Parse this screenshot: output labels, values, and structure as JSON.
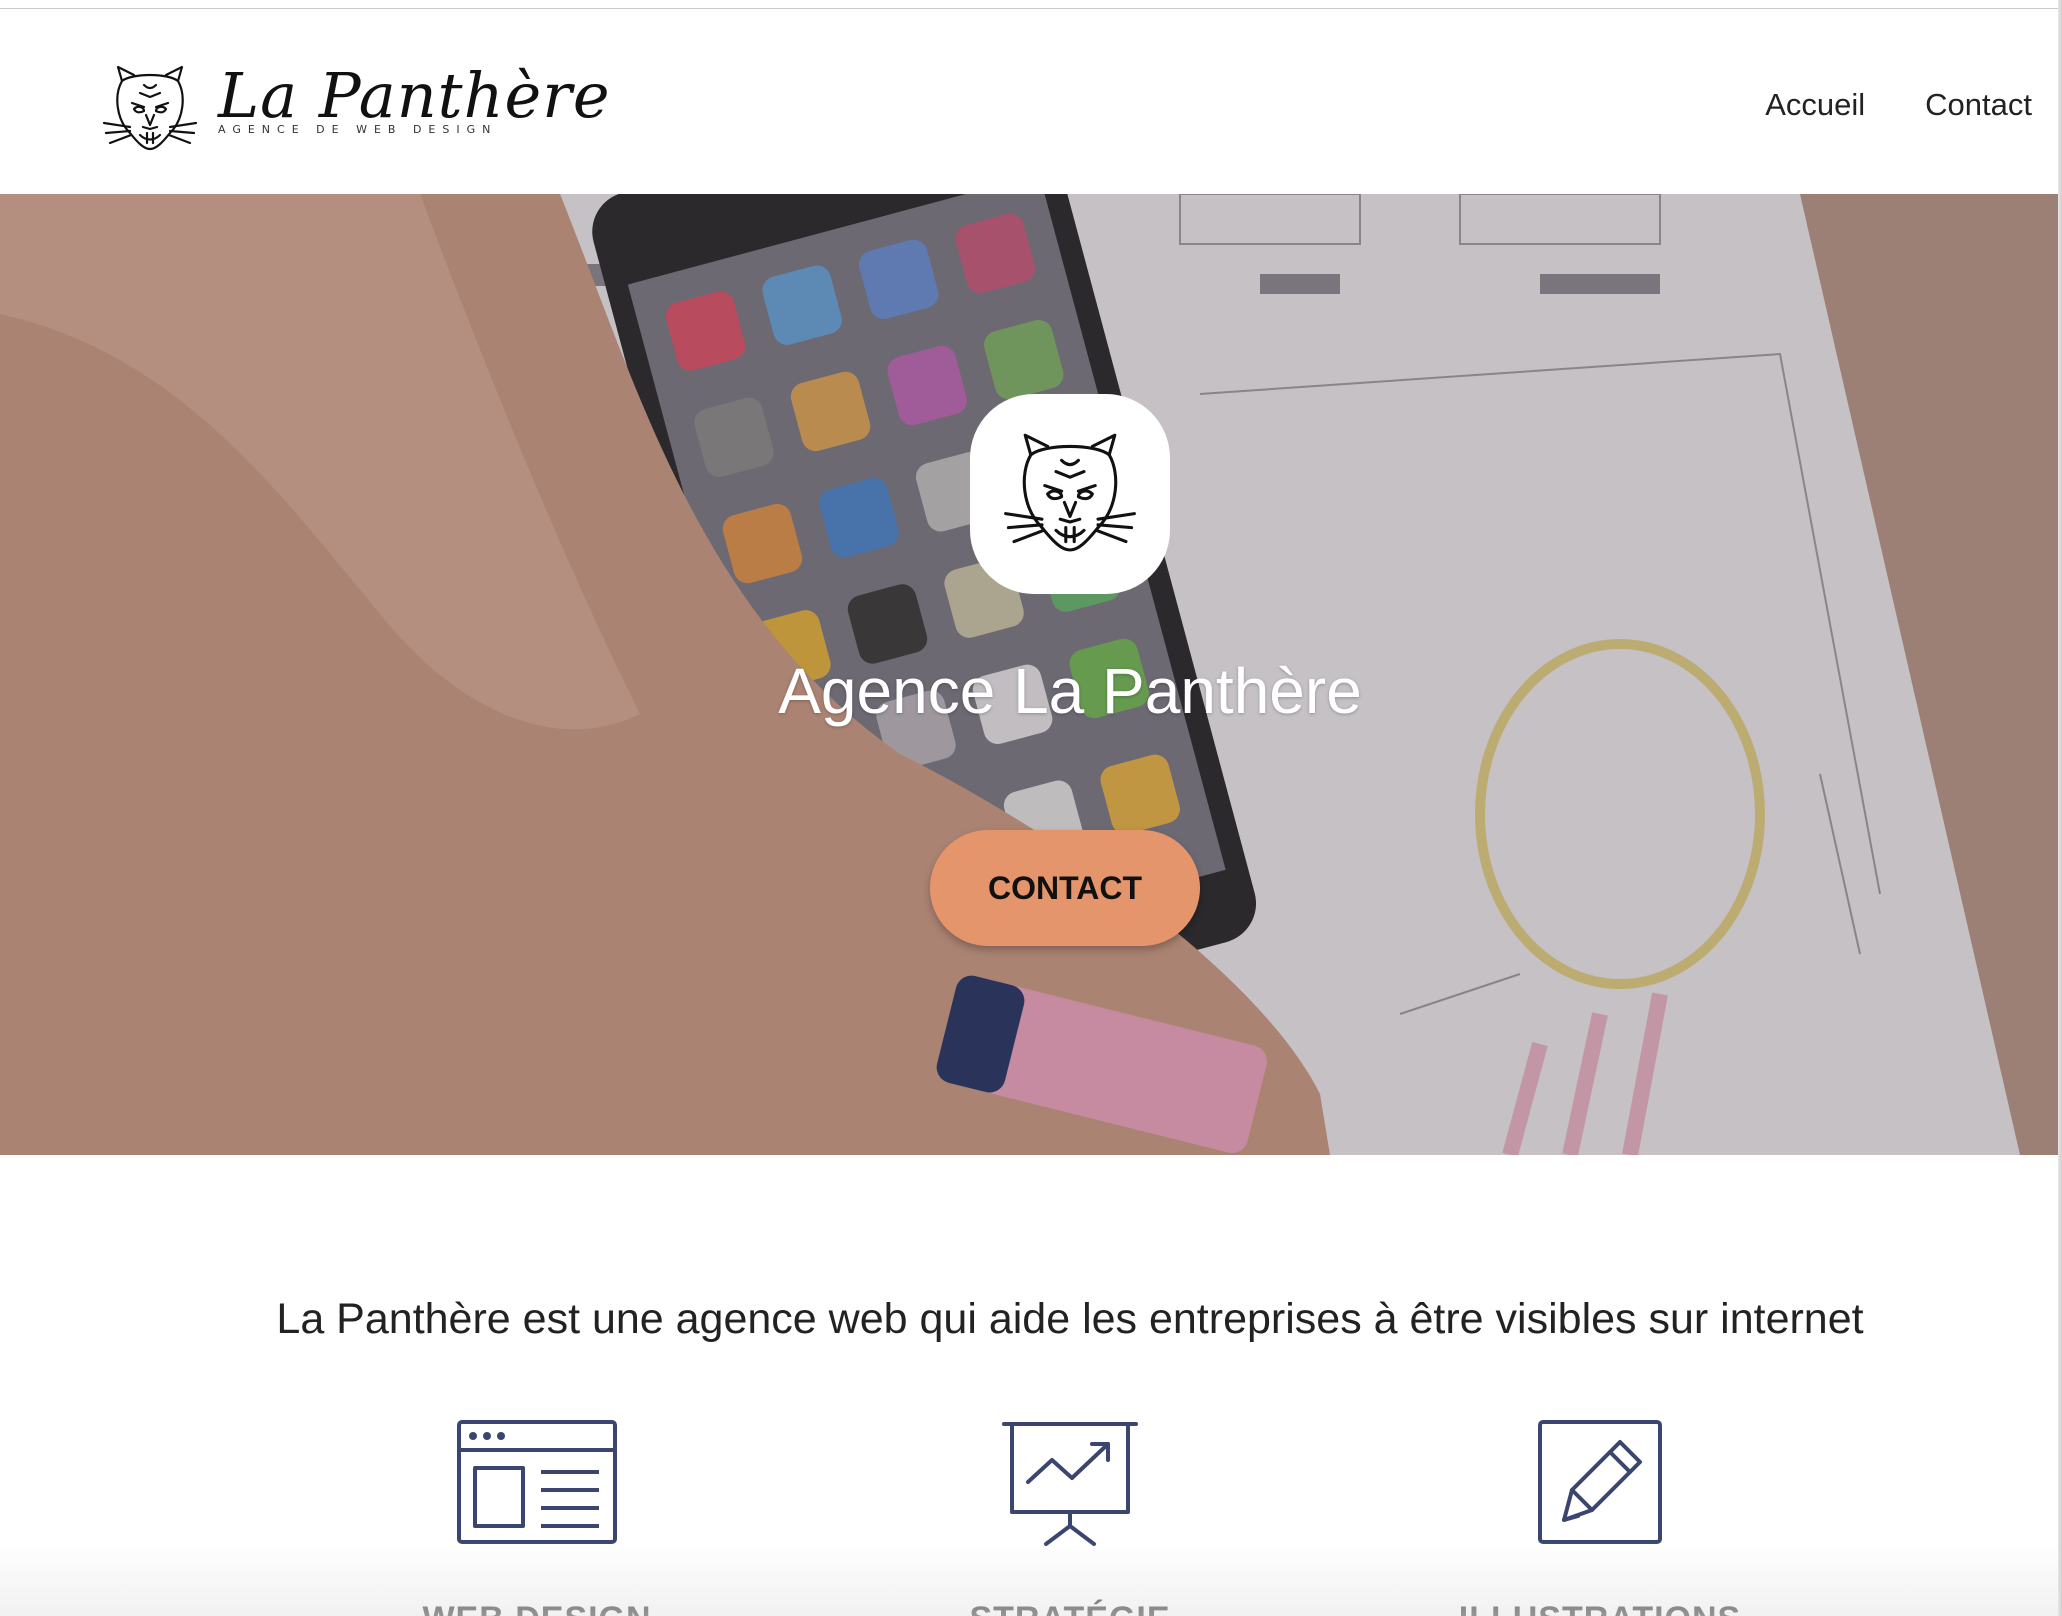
{
  "header": {
    "logo_title": "La Panthère",
    "logo_subtitle": "AGENCE DE WEB DESIGN",
    "nav": [
      {
        "label": "Accueil"
      },
      {
        "label": "Contact"
      }
    ]
  },
  "hero": {
    "title": "Agence La Panthère",
    "button_label": "CONTACT",
    "button_color": "#e5956c"
  },
  "intro": {
    "text": "La Panthère est une agence web qui aide les entreprises à être visibles sur internet"
  },
  "services": [
    {
      "label": "WEB DESIGN",
      "icon": "browser-layout-icon"
    },
    {
      "label": "STRATÉGIE",
      "icon": "presentation-chart-icon"
    },
    {
      "label": "ILLUSTRATIONS",
      "icon": "pencil-icon"
    }
  ],
  "colors": {
    "icon_navy": "#3a4570",
    "accent": "#e5956c"
  }
}
